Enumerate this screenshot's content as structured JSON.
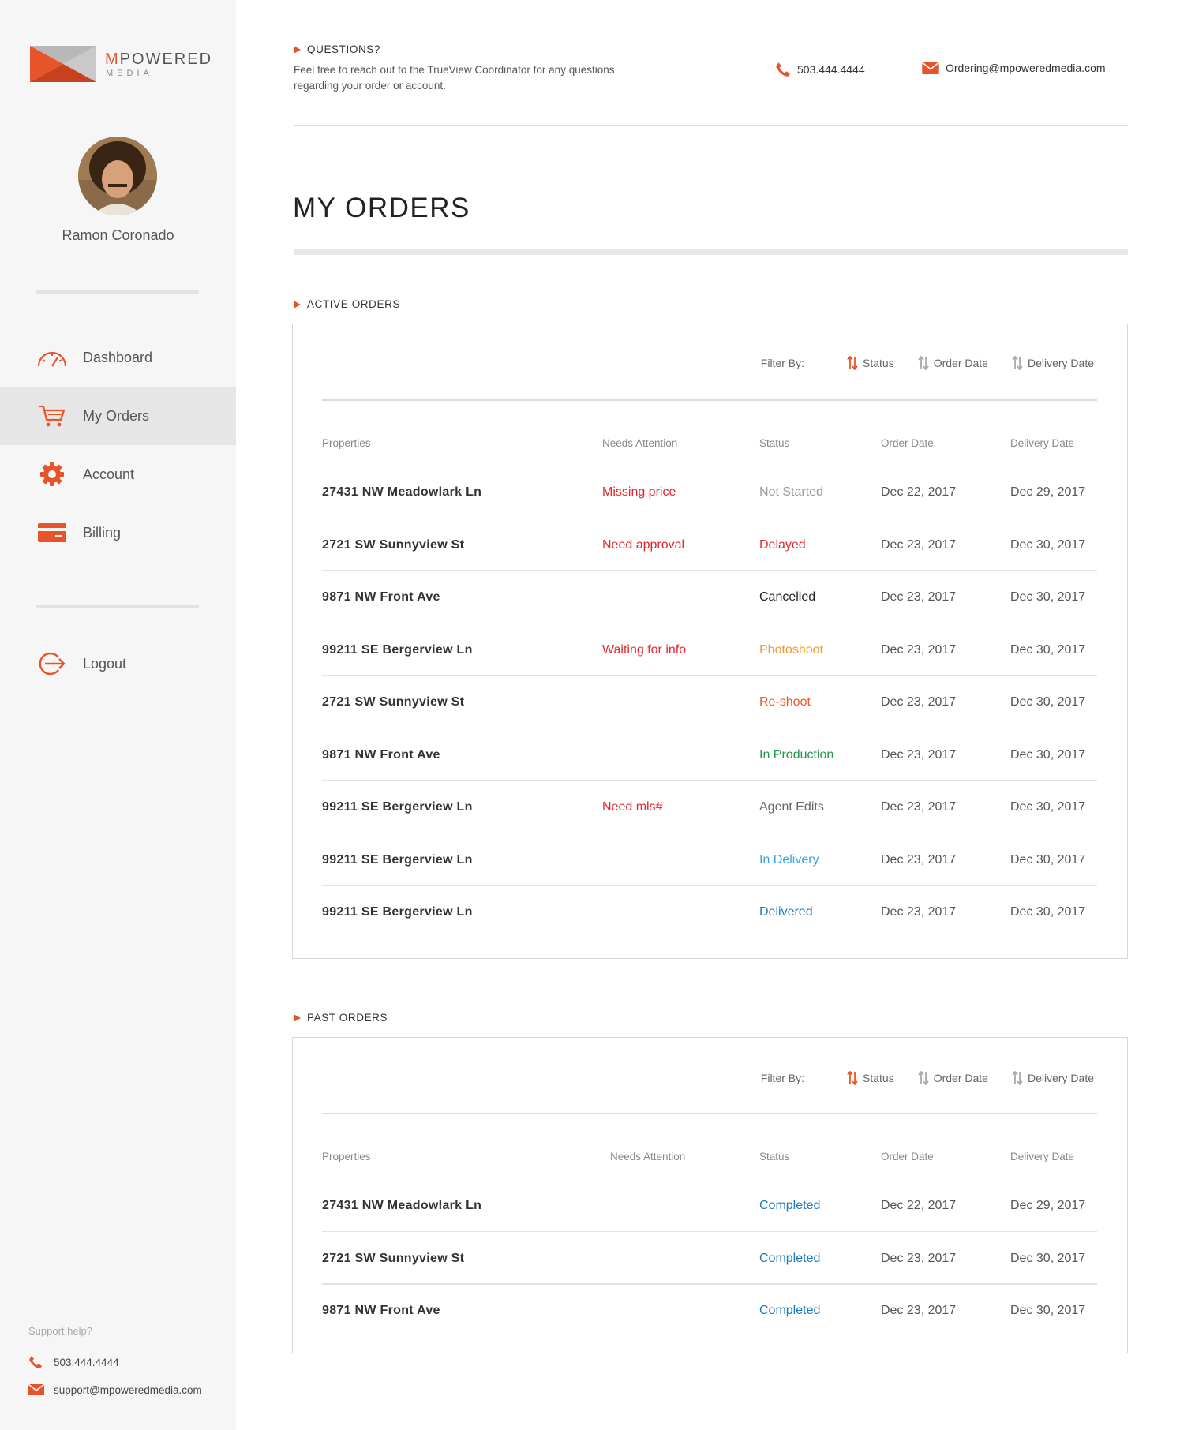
{
  "brand": {
    "name_first": "M",
    "name_rest": "POWERED",
    "sub": "MEDIA",
    "colors": {
      "accent": "#e8542a",
      "dark_accent": "#c8411e",
      "gray": "#bdbdbd"
    }
  },
  "user": {
    "name": "Ramon Coronado"
  },
  "nav": {
    "items": [
      {
        "label": "Dashboard",
        "icon": "speedometer-icon"
      },
      {
        "label": "My Orders",
        "icon": "cart-icon",
        "active": true
      },
      {
        "label": "Account",
        "icon": "gear-icon"
      },
      {
        "label": "Billing",
        "icon": "credit-card-icon"
      }
    ],
    "logout": "Logout"
  },
  "support": {
    "title": "Support help?",
    "phone": "503.444.4444",
    "email": "support@mpoweredmedia.com"
  },
  "header": {
    "questions_title": "QUESTIONS?",
    "questions_body": "Feel free to reach out to the TrueView Coordinator for any questions regarding your order or account.",
    "phone": "503.444.4444",
    "email": "Ordering@mpoweredmedia.com"
  },
  "page_title": "MY ORDERS",
  "filter": {
    "label": "Filter By:",
    "options": [
      "Status",
      "Order Date",
      "Delivery Date"
    ]
  },
  "columns": [
    "Properties",
    "Needs Attention",
    "Status",
    "Order Date",
    "Delivery Date"
  ],
  "active_orders": {
    "title": "ACTIVE ORDERS",
    "rows": [
      {
        "property": "27431 NW Meadowlark Ln",
        "needs": "Missing price",
        "status": "Not Started",
        "status_color": "#9a9a9a",
        "order_date": "Dec 22, 2017",
        "delivery_date": "Dec 29, 2017"
      },
      {
        "property": "2721 SW Sunnyview St",
        "needs": "Need approval",
        "status": "Delayed",
        "status_color": "#e0282e",
        "order_date": "Dec 23, 2017",
        "delivery_date": "Dec 30, 2017"
      },
      {
        "property": "9871 NW Front Ave",
        "needs": "",
        "status": "Cancelled",
        "status_color": "#222222",
        "order_date": "Dec 23, 2017",
        "delivery_date": "Dec 30, 2017"
      },
      {
        "property": "99211 SE Bergerview Ln",
        "needs": "Waiting for info",
        "status": "Photoshoot",
        "status_color": "#f29a2e",
        "order_date": "Dec 23, 2017",
        "delivery_date": "Dec 30, 2017"
      },
      {
        "property": "2721 SW Sunnyview St",
        "needs": "",
        "status": "Re-shoot",
        "status_color": "#ea5a2a",
        "order_date": "Dec 23, 2017",
        "delivery_date": "Dec 30, 2017"
      },
      {
        "property": "9871 NW Front Ave",
        "needs": "",
        "status": "In Production",
        "status_color": "#1e9a4a",
        "order_date": "Dec 23, 2017",
        "delivery_date": "Dec 30, 2017"
      },
      {
        "property": "99211 SE Bergerview Ln",
        "needs": "Need mls#",
        "status": "Agent Edits",
        "status_color": "#666666",
        "order_date": "Dec 23, 2017",
        "delivery_date": "Dec 30, 2017"
      },
      {
        "property": "99211 SE Bergerview Ln",
        "needs": "",
        "status": "In Delivery",
        "status_color": "#3aa3dc",
        "order_date": "Dec 23, 2017",
        "delivery_date": "Dec 30, 2017"
      },
      {
        "property": "99211 SE Bergerview Ln",
        "needs": "",
        "status": "Delivered",
        "status_color": "#1b79c0",
        "order_date": "Dec 23, 2017",
        "delivery_date": "Dec 30, 2017"
      }
    ]
  },
  "past_orders": {
    "title": "PAST ORDERS",
    "rows": [
      {
        "property": "27431 NW Meadowlark Ln",
        "needs": "",
        "status": "Completed",
        "status_color": "#1b79c0",
        "order_date": "Dec 22, 2017",
        "delivery_date": "Dec 29, 2017"
      },
      {
        "property": "2721 SW Sunnyview St",
        "needs": "",
        "status": "Completed",
        "status_color": "#1b79c0",
        "order_date": "Dec 23, 2017",
        "delivery_date": "Dec 30, 2017"
      },
      {
        "property": "9871 NW Front Ave",
        "needs": "",
        "status": "Completed",
        "status_color": "#1b79c0",
        "order_date": "Dec 23, 2017",
        "delivery_date": "Dec 30, 2017"
      }
    ]
  }
}
